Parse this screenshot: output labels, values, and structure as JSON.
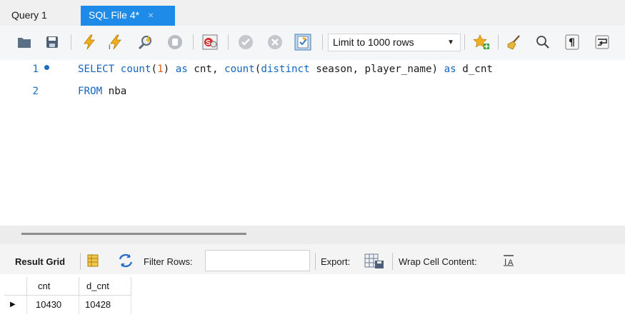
{
  "tabs": [
    {
      "label": "Query 1"
    },
    {
      "label": "SQL File 4*",
      "close": "×"
    }
  ],
  "toolbar": {
    "limit": "Limit to 1000 rows"
  },
  "editor": {
    "lines": [
      {
        "number": "1"
      },
      {
        "number": "2"
      }
    ]
  },
  "results": {
    "grid_label": "Result Grid",
    "filter_label": "Filter Rows:",
    "filter_value": "",
    "export_label": "Export:",
    "wrap_label": "Wrap Cell Content:",
    "columns": [
      "cnt",
      "d_cnt"
    ],
    "rows": [
      [
        "10430",
        "10428"
      ]
    ]
  },
  "colors": {
    "active_tab": "#1e8be8",
    "keyword": "#1565c0",
    "number": "#e35d0f"
  }
}
